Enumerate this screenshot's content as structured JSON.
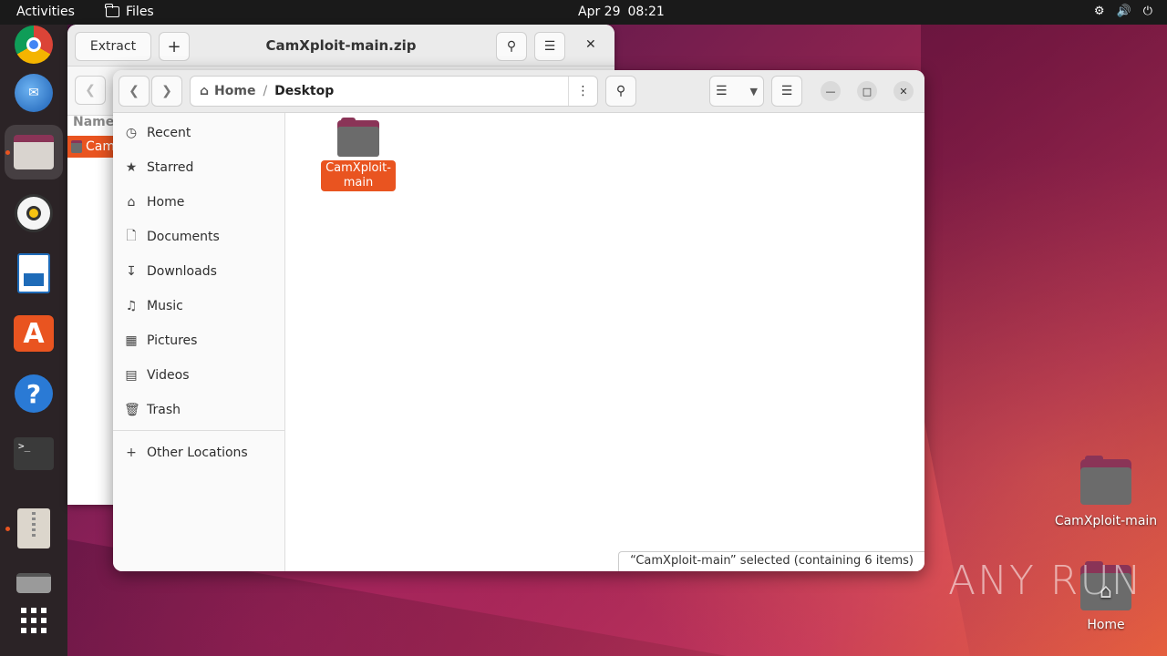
{
  "topbar": {
    "activities": "Activities",
    "app_name": "Files",
    "date": "Apr 29",
    "time": "08:21",
    "tray": [
      "network-icon",
      "volume-icon",
      "power-icon"
    ]
  },
  "dock": {
    "items": [
      "chrome",
      "thunderbird",
      "files",
      "rhythmbox",
      "libreoffice-writer",
      "app-center",
      "help",
      "terminal",
      "archive-manager",
      "disks",
      "show-apps"
    ]
  },
  "archive_window": {
    "extract_label": "Extract",
    "title": "CamXploit-main.zip",
    "column_name": "Name",
    "selected_item": "Cam"
  },
  "files_window": {
    "path": {
      "home": "Home",
      "separator": "/",
      "current": "Desktop"
    },
    "sidebar": {
      "items": [
        {
          "label": "Recent",
          "icon": "clock-icon"
        },
        {
          "label": "Starred",
          "icon": "star-icon"
        },
        {
          "label": "Home",
          "icon": "home-icon"
        },
        {
          "label": "Documents",
          "icon": "document-icon"
        },
        {
          "label": "Downloads",
          "icon": "download-icon"
        },
        {
          "label": "Music",
          "icon": "music-icon"
        },
        {
          "label": "Pictures",
          "icon": "picture-icon"
        },
        {
          "label": "Videos",
          "icon": "video-icon"
        },
        {
          "label": "Trash",
          "icon": "trash-icon"
        }
      ],
      "other_locations": "Other Locations"
    },
    "items": [
      {
        "label": "CamXploit-main"
      }
    ],
    "status": "“CamXploit-main” selected  (containing 6 items)"
  },
  "desktop": {
    "icons": [
      {
        "label": "CamXploit-main"
      },
      {
        "label": "Home"
      }
    ],
    "watermark": "ANY RUN"
  },
  "colors": {
    "accent": "#e95420",
    "topbar": "#1a1a1a",
    "dock": "#2b2326"
  }
}
